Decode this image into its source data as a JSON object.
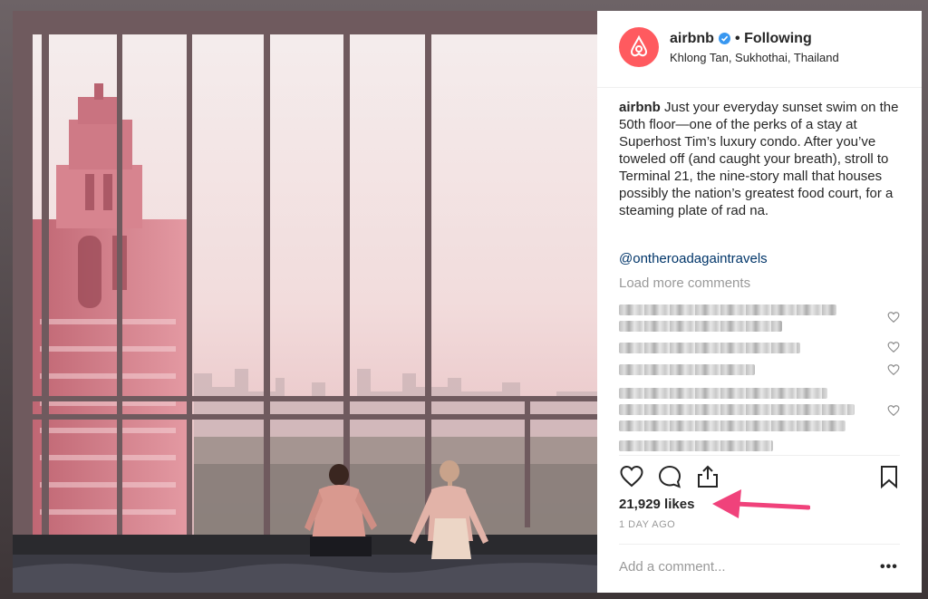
{
  "post": {
    "username": "airbnb",
    "follow_separator": "•",
    "follow_label": "Following",
    "location": "Khlong Tan, Sukhothai, Thailand",
    "caption_user": "airbnb",
    "caption_text": "Just your everyday sunset swim on the 50th floor—one of the perks of a stay at Superhost Tim’s luxury condo. After you’ve toweled off (and caught your breath), stroll to Terminal 21, the nine-story mall that houses possibly the nation’s greatest food court, for a steaming plate of rad na.",
    "mention": "@ontheroadagaintravels",
    "load_more": "Load more comments",
    "likes": "21,929 likes",
    "timestamp": "1 DAY AGO",
    "add_comment_placeholder": "Add a comment...",
    "more_options": "•••"
  },
  "icons": {
    "avatar": "airbnb-logo-icon",
    "verified": "verified-badge-icon",
    "like": "heart-icon",
    "comment": "comment-icon",
    "share": "share-icon",
    "save": "bookmark-icon",
    "annotation": "arrow-icon"
  },
  "colors": {
    "brand": "#ff5a5f",
    "verified": "#3897f0",
    "mention": "#003569",
    "annotation_arrow": "#f0427b"
  }
}
